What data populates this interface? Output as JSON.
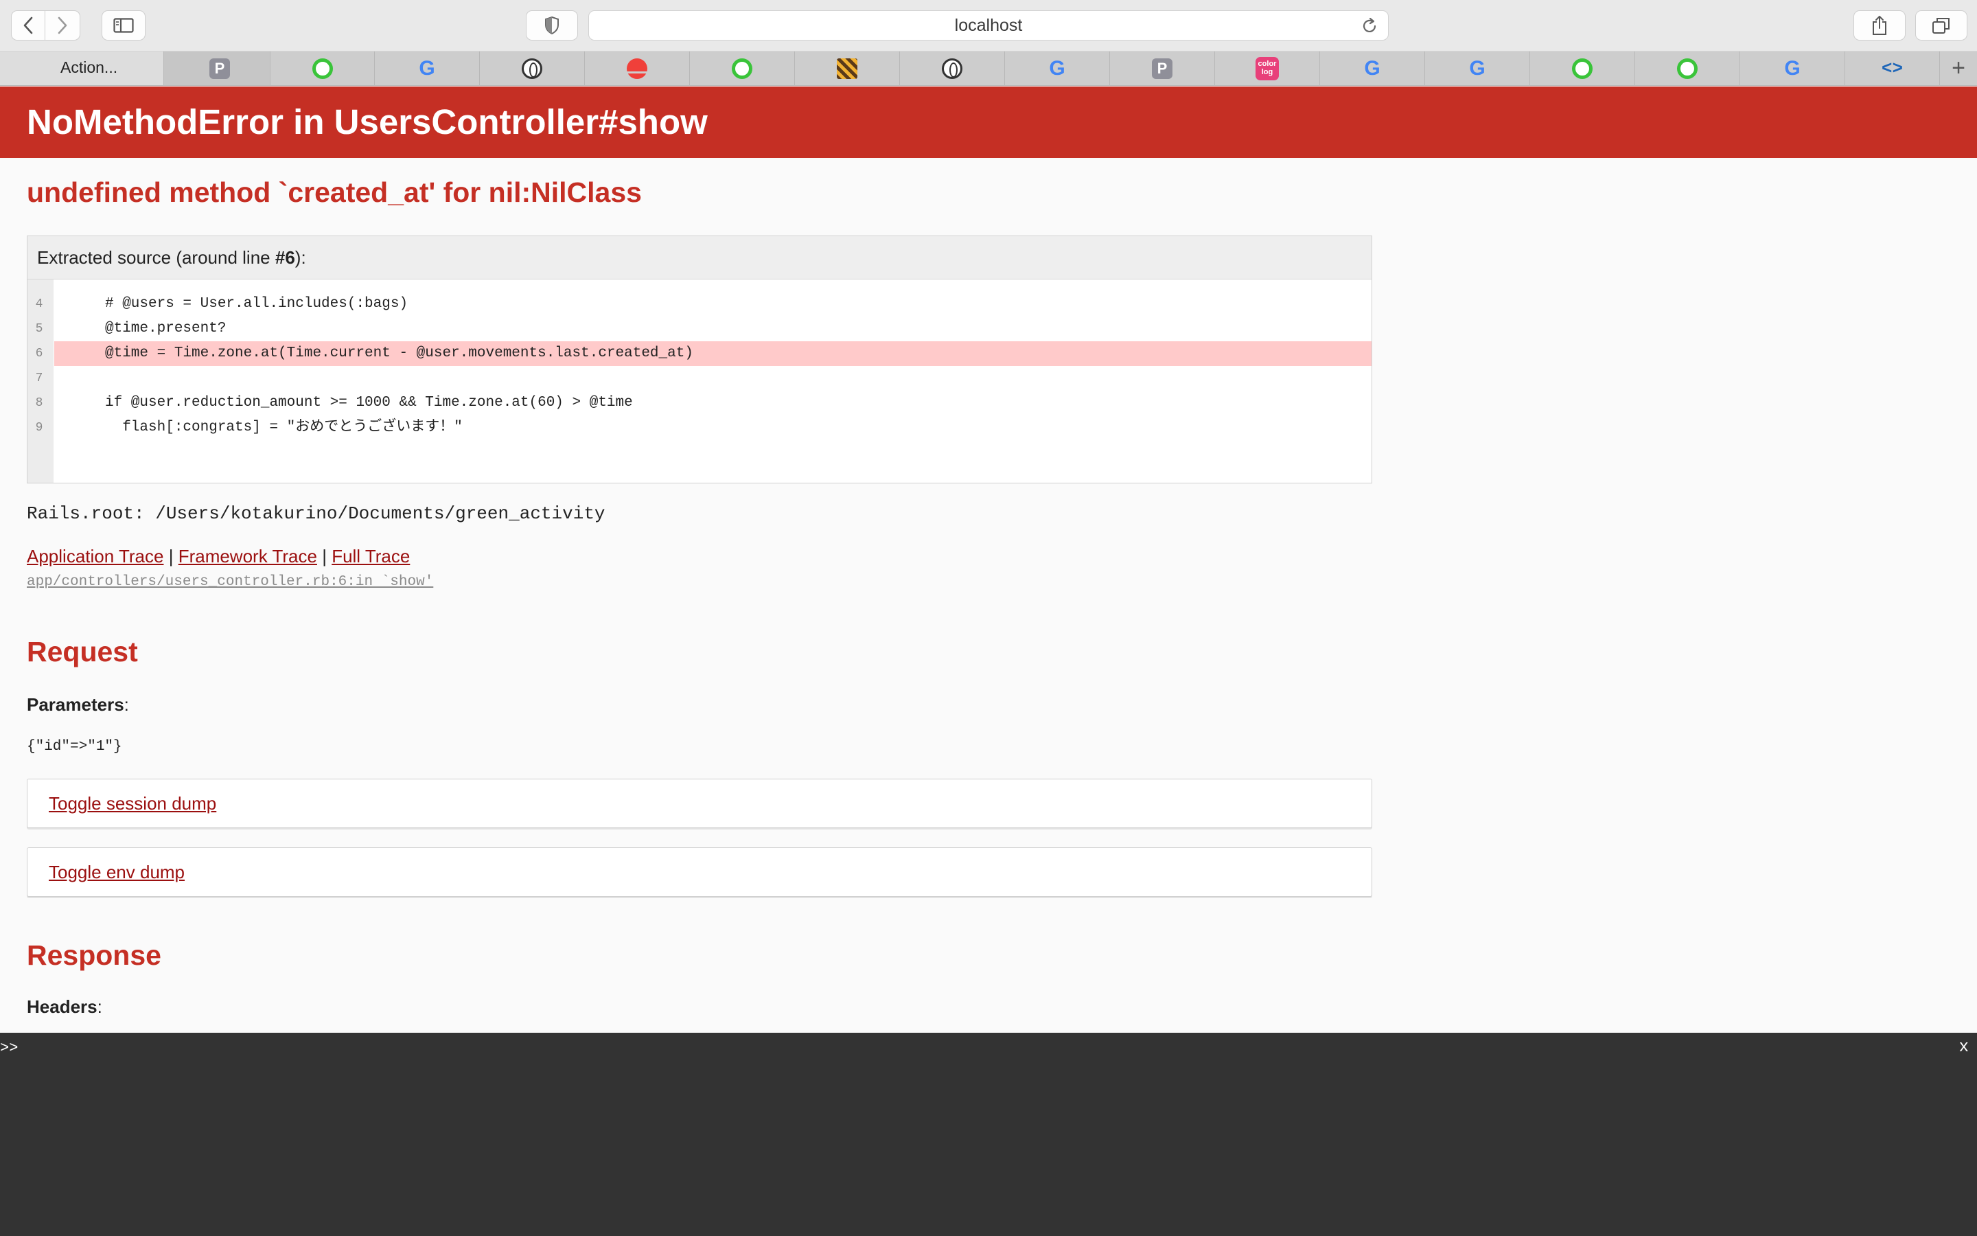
{
  "browser": {
    "url": "localhost",
    "active_tab_title": "Action...",
    "tab_close_glyph": "×",
    "new_tab_glyph": "+",
    "tabs": [
      {
        "icon": "p-icon",
        "label": "P"
      },
      {
        "icon": "green-q-icon"
      },
      {
        "icon": "google-icon",
        "label": "G"
      },
      {
        "icon": "oval-logo-icon"
      },
      {
        "icon": "red-sun-icon"
      },
      {
        "icon": "green-q-icon"
      },
      {
        "icon": "checkered-icon"
      },
      {
        "icon": "oval-logo-icon"
      },
      {
        "icon": "google-icon",
        "label": "G"
      },
      {
        "icon": "p-icon",
        "label": "P"
      },
      {
        "icon": "color-tag-icon",
        "label": "color log"
      },
      {
        "icon": "google-icon",
        "label": "G"
      },
      {
        "icon": "google-icon",
        "label": "G"
      },
      {
        "icon": "green-q-icon"
      },
      {
        "icon": "green-q-icon"
      },
      {
        "icon": "google-icon",
        "label": "G"
      },
      {
        "icon": "code-brackets-icon",
        "label": "<>"
      }
    ]
  },
  "error": {
    "title": "NoMethodError in UsersController#show",
    "message": "undefined method `created_at' for nil:NilClass"
  },
  "source": {
    "header_prefix": "Extracted source (around line ",
    "header_line": "#6",
    "header_suffix": "):",
    "lines": [
      {
        "num": "4",
        "code": "# @users = User.all.includes(:bags)"
      },
      {
        "num": "5",
        "code": "@time.present?"
      },
      {
        "num": "6",
        "code": "@time = Time.zone.at(Time.current - @user.movements.last.created_at)"
      },
      {
        "num": "7",
        "code": ""
      },
      {
        "num": "8",
        "code": "if @user.reduction_amount >= 1000 && Time.zone.at(60) > @time"
      },
      {
        "num": "9",
        "code": "  flash[:congrats] = \"おめでとうございます！\""
      }
    ]
  },
  "rails_root": "Rails.root: /Users/kotakurino/Documents/green_activity",
  "trace": {
    "application": "Application Trace",
    "framework": "Framework Trace",
    "full": "Full Trace",
    "separator": "|",
    "line": "app/controllers/users_controller.rb:6:in `show'"
  },
  "request": {
    "heading": "Request",
    "parameters_label": "Parameters",
    "parameters_value": "{\"id\"=>\"1\"}",
    "toggle_session": "Toggle session dump",
    "toggle_env": "Toggle env dump"
  },
  "response": {
    "heading": "Response",
    "headers_label": "Headers"
  },
  "console": {
    "prompt": ">>",
    "close": "x"
  },
  "colors": {
    "header_red": "#c52f24",
    "link_red": "#9b0f0f",
    "highlight_line": "#ffcaca",
    "console_bg": "#333333"
  }
}
